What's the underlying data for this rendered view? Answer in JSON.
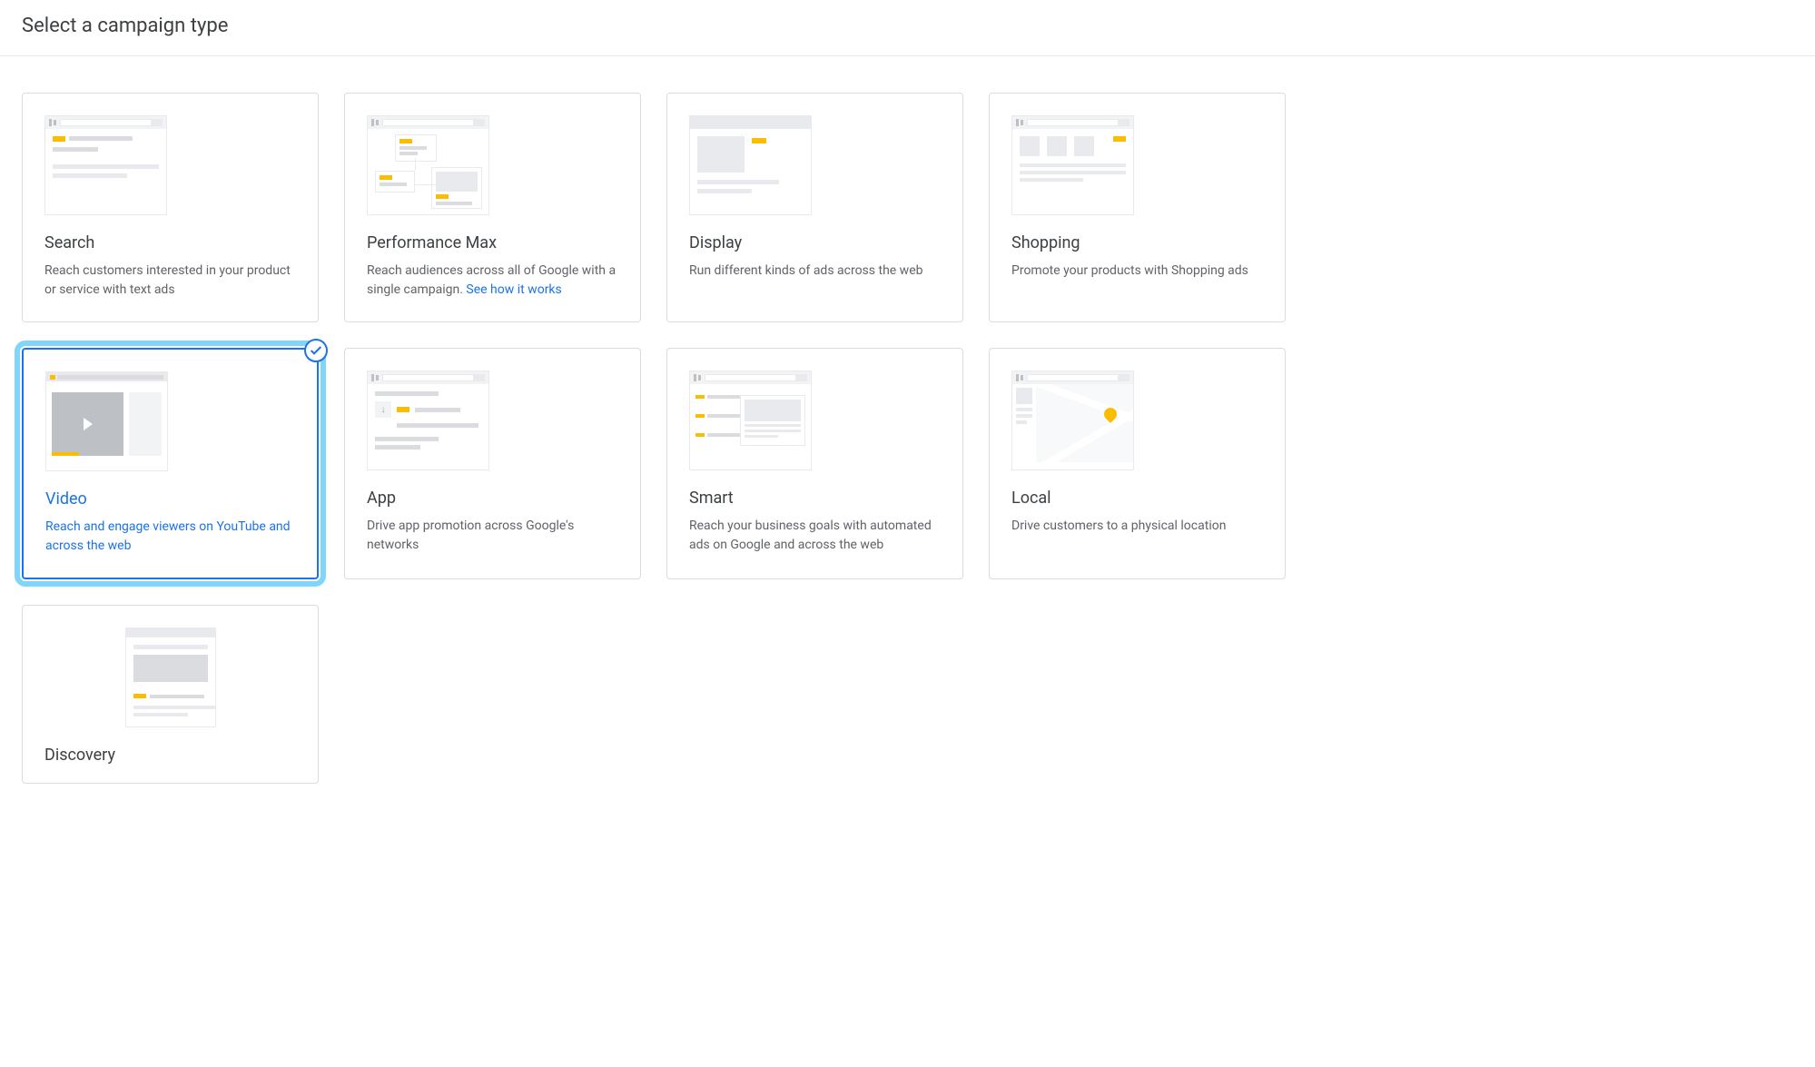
{
  "header": {
    "title": "Select a campaign type"
  },
  "selected_campaign": "video",
  "campaigns": {
    "search": {
      "title": "Search",
      "description": "Reach customers interested in your product or service with text ads"
    },
    "performance_max": {
      "title": "Performance Max",
      "description": "Reach audiences across all of Google with a single campaign.",
      "link_text": "See how it works"
    },
    "display": {
      "title": "Display",
      "description": "Run different kinds of ads across the web"
    },
    "shopping": {
      "title": "Shopping",
      "description": "Promote your products with Shopping ads"
    },
    "video": {
      "title": "Video",
      "description": "Reach and engage viewers on YouTube and across the web"
    },
    "app": {
      "title": "App",
      "description": "Drive app promotion across Google's networks"
    },
    "smart": {
      "title": "Smart",
      "description": "Reach your business goals with automated ads on Google and across the web"
    },
    "local": {
      "title": "Local",
      "description": "Drive customers to a physical location"
    },
    "discovery": {
      "title": "Discovery",
      "description": ""
    }
  },
  "colors": {
    "accent_blue": "#1a73e8",
    "highlight_cyan": "#81d4fa",
    "accent_yellow": "#fbbc04",
    "border_gray": "#dadce0",
    "text_primary": "#3c4043",
    "text_secondary": "#5f6368"
  }
}
